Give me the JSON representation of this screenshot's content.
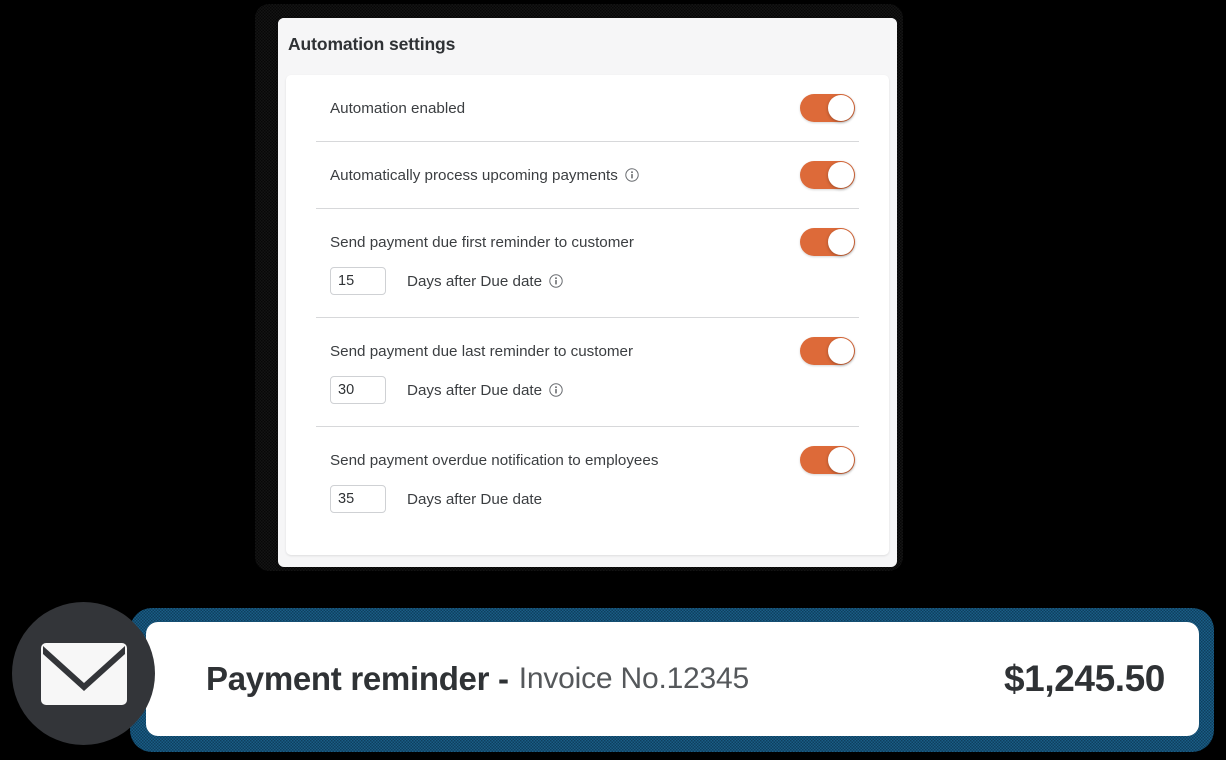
{
  "card": {
    "title": "Automation settings",
    "rows": [
      {
        "label": "Automation enabled",
        "has_info": false,
        "toggle_on": true,
        "days": null
      },
      {
        "label": "Automatically process upcoming payments",
        "has_info": true,
        "toggle_on": true,
        "days": null
      },
      {
        "label": "Send payment due first reminder to customer",
        "has_info": false,
        "toggle_on": true,
        "days": {
          "value": "15",
          "label": "Days after Due date",
          "has_info": true
        }
      },
      {
        "label": "Send payment due last reminder to customer",
        "has_info": false,
        "toggle_on": true,
        "days": {
          "value": "30",
          "label": "Days after Due date",
          "has_info": true
        }
      },
      {
        "label": "Send payment overdue notification to employees",
        "has_info": false,
        "toggle_on": true,
        "days": {
          "value": "35",
          "label": "Days after Due date",
          "has_info": false
        }
      }
    ]
  },
  "banner": {
    "icon": "envelope-icon",
    "title": "Payment reminder -",
    "subtitle": "Invoice No.12345",
    "amount": "$1,245.50"
  },
  "colors": {
    "toggle_on": "#dd6a39",
    "banner_border": "#15567f",
    "badge": "#333539",
    "text": "#2f3235",
    "background": "#000000"
  }
}
